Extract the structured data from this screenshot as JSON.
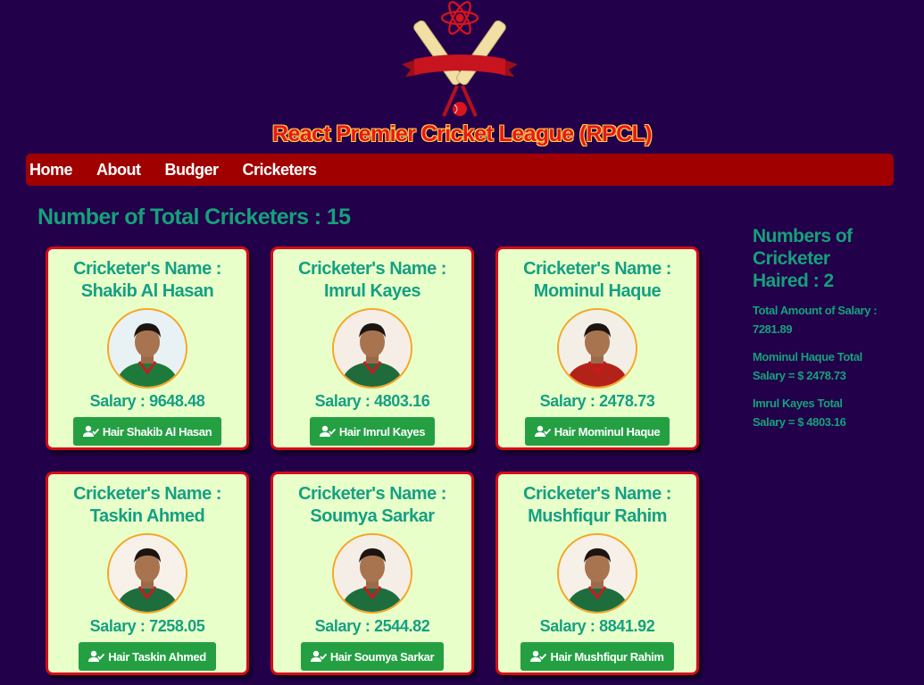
{
  "header": {
    "title": "React Premier Cricket League (RPCL)"
  },
  "nav": {
    "items": [
      "Home",
      "About",
      "Budger",
      "Cricketers"
    ]
  },
  "total": {
    "text": "Number of Total Cricketers : 15"
  },
  "cards": [
    {
      "name": "Cricketer's Name : Shakib Al Hasan",
      "salary": "Salary : 9648.48",
      "button": "Hair Shakib Al Hasan",
      "bg": "#e8f1f4",
      "jersey": "#1e7a3a"
    },
    {
      "name": "Cricketer's Name : Imrul Kayes",
      "salary": "Salary : 4803.16",
      "button": "Hair Imrul Kayes",
      "bg": "#f6ede6",
      "jersey": "#1f6b3c"
    },
    {
      "name": "Cricketer's Name : Mominul Haque",
      "salary": "Salary : 2478.73",
      "button": "Hair Mominul Haque",
      "bg": "#f3efe6",
      "jersey": "#b32218"
    },
    {
      "name": "Cricketer's Name : Taskin Ahmed",
      "salary": "Salary : 7258.05",
      "button": "Hair Taskin Ahmed",
      "bg": "#f7f1ea",
      "jersey": "#1e6e3d"
    },
    {
      "name": "Cricketer's Name : Soumya Sarkar",
      "salary": "Salary : 2544.82",
      "button": "Hair Soumya Sarkar",
      "bg": "#f4eee6",
      "jersey": "#1e6e3d"
    },
    {
      "name": "Cricketer's Name : Mushfiqur Rahim",
      "salary": "Salary : 8841.92",
      "button": "Hair Mushfiqur Rahim",
      "bg": "#f6f0e8",
      "jersey": "#1e6e3d"
    }
  ],
  "sidebar": {
    "count": "Numbers of Cricketer Haired : 2",
    "total_salary": "Total Amount of Salary : 7281.89",
    "hired": [
      "Mominul Haque Total Salary = $ 2478.73",
      "Imrul Kayes Total Salary = $ 4803.16"
    ]
  },
  "colors": {
    "background": "#22004a",
    "nav": "#a00000",
    "accent": "#16a07a",
    "card": "#e9ffc9",
    "button": "#24a043"
  },
  "icons": {
    "hire": "user-check-icon",
    "logo": "react-cricket-logo"
  }
}
